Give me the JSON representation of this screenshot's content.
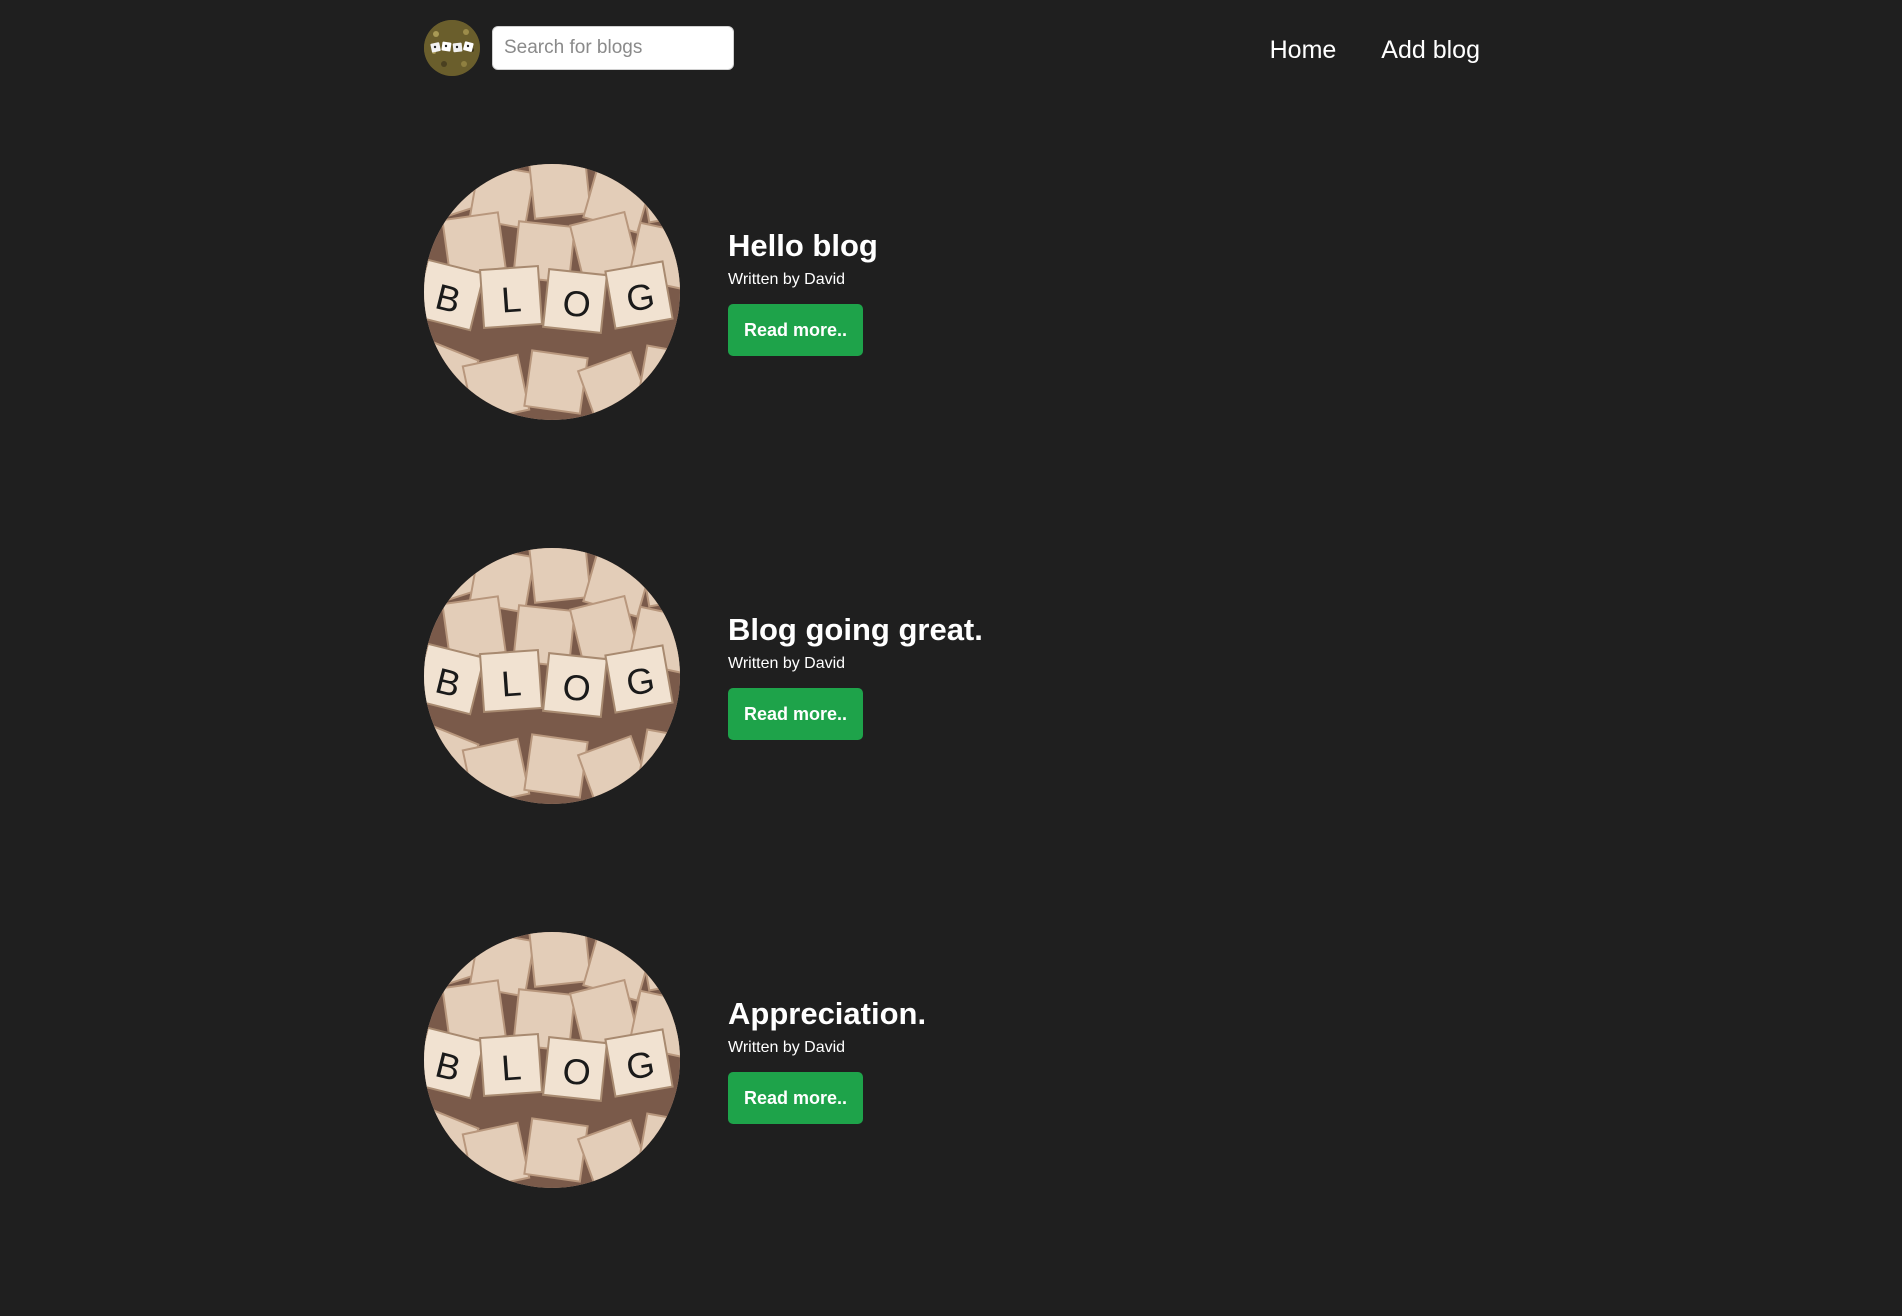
{
  "navbar": {
    "logo_icon": "blog-dice-logo-icon",
    "search": {
      "placeholder": "Search for blogs",
      "value": ""
    },
    "links": [
      {
        "label": "Home"
      },
      {
        "label": "Add blog"
      }
    ]
  },
  "posts": [
    {
      "title": "Hello blog",
      "author": "Written by David",
      "button": "Read more..",
      "thumbnail_icon": "scrabble-blog-tiles-image"
    },
    {
      "title": "Blog going great.",
      "author": "Written by David",
      "button": "Read more..",
      "thumbnail_icon": "scrabble-blog-tiles-image"
    },
    {
      "title": "Appreciation.",
      "author": "Written by David",
      "button": "Read more..",
      "thumbnail_icon": "scrabble-blog-tiles-image"
    }
  ],
  "thumbnail_tile_letters": [
    "B",
    "L",
    "O",
    "G"
  ],
  "colors": {
    "background": "#1f1f1f",
    "button": "#1ea34a",
    "text": "#ffffff"
  }
}
